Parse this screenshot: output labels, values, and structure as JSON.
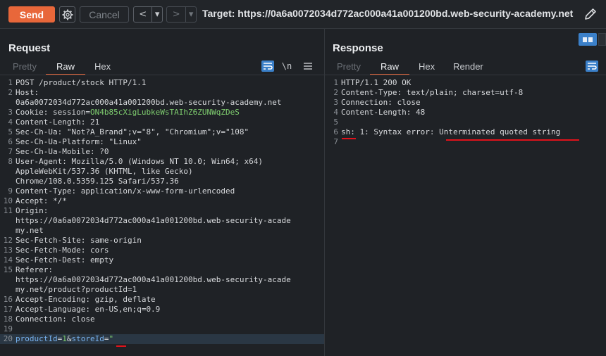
{
  "toolbar": {
    "send_label": "Send",
    "cancel_label": "Cancel",
    "back_label": "<",
    "back_dropdown": "▾",
    "forward_label": ">",
    "forward_dropdown": "▾",
    "target_label": "Target: https://0a6a0072034d772ac000a41a001200bd.web-security-academy.net",
    "gear_icon": "gear-icon",
    "edit_icon": "pencil-icon"
  },
  "colors": {
    "accent": "#e8673a",
    "highlight_blue": "#3b80c9",
    "annotation_red": "#e0121b"
  },
  "request": {
    "title": "Request",
    "tabs": [
      "Pretty",
      "Raw",
      "Hex"
    ],
    "active_tab": "Raw",
    "icons": [
      "wrap-icon",
      "newline-icon",
      "menu-icon"
    ],
    "newline_label": "\\n",
    "lines": [
      {
        "n": "1",
        "k": "",
        "v": "POST /product/stock HTTP/1.1"
      },
      {
        "n": "2",
        "k": "Host:",
        "v": ""
      },
      {
        "n": "",
        "k": "",
        "v": "0a6a0072034d772ac000a41a001200bd.web-security-academy.net"
      },
      {
        "n": "3",
        "k": "Cookie:",
        "v": " session=",
        "g": "ON4b85cXigLubkeWsTAIhZ6ZUNWqZDeS"
      },
      {
        "n": "4",
        "k": "Content-Length:",
        "v": " 21"
      },
      {
        "n": "5",
        "k": "Sec-Ch-Ua:",
        "v": " \"Not?A_Brand\";v=\"8\", \"Chromium\";v=\"108\""
      },
      {
        "n": "6",
        "k": "Sec-Ch-Ua-Platform:",
        "v": " \"Linux\""
      },
      {
        "n": "7",
        "k": "Sec-Ch-Ua-Mobile:",
        "v": " ?0"
      },
      {
        "n": "8",
        "k": "User-Agent:",
        "v": " Mozilla/5.0 (Windows NT 10.0; Win64; x64)"
      },
      {
        "n": "",
        "k": "",
        "v": "AppleWebKit/537.36 (KHTML, like Gecko)"
      },
      {
        "n": "",
        "k": "",
        "v": "Chrome/108.0.5359.125 Safari/537.36"
      },
      {
        "n": "9",
        "k": "Content-Type:",
        "v": " application/x-www-form-urlencoded"
      },
      {
        "n": "10",
        "k": "Accept:",
        "v": " */*"
      },
      {
        "n": "11",
        "k": "Origin:",
        "v": ""
      },
      {
        "n": "",
        "k": "",
        "v": "https://0a6a0072034d772ac000a41a001200bd.web-security-acade"
      },
      {
        "n": "",
        "k": "",
        "v": "my.net"
      },
      {
        "n": "12",
        "k": "Sec-Fetch-Site:",
        "v": " same-origin"
      },
      {
        "n": "13",
        "k": "Sec-Fetch-Mode:",
        "v": " cors"
      },
      {
        "n": "14",
        "k": "Sec-Fetch-Dest:",
        "v": " empty"
      },
      {
        "n": "15",
        "k": "Referer:",
        "v": ""
      },
      {
        "n": "",
        "k": "",
        "v": "https://0a6a0072034d772ac000a41a001200bd.web-security-acade"
      },
      {
        "n": "",
        "k": "",
        "v": "my.net/product?productId=1"
      },
      {
        "n": "16",
        "k": "Accept-Encoding:",
        "v": " gzip, deflate"
      },
      {
        "n": "17",
        "k": "Accept-Language:",
        "v": " en-US,en;q=0.9"
      },
      {
        "n": "18",
        "k": "Connection:",
        "v": " close"
      },
      {
        "n": "19",
        "k": "",
        "v": ""
      },
      {
        "n": "20",
        "k": "",
        "v": "",
        "body": true
      }
    ],
    "body_line": {
      "p1": "productId",
      "e1": "=",
      "v1": "1",
      "amp": "&",
      "p2": "storeId",
      "e2": "=",
      "v2": "\""
    }
  },
  "response": {
    "title": "Response",
    "tabs": [
      "Pretty",
      "Raw",
      "Hex",
      "Render"
    ],
    "active_tab": "Raw",
    "icons": [
      "wrap-icon",
      "split-view-icon"
    ],
    "lines": [
      {
        "n": "1",
        "k": "",
        "v": "HTTP/1.1 200 OK"
      },
      {
        "n": "2",
        "k": "Content-Type:",
        "v": " text/plain; charset=utf-8"
      },
      {
        "n": "3",
        "k": "Connection:",
        "v": " close"
      },
      {
        "n": "4",
        "k": "Content-Length:",
        "v": " 48"
      },
      {
        "n": "5",
        "k": "",
        "v": ""
      },
      {
        "n": "6",
        "k": "",
        "v": "sh: 1: Syntax error: Unterminated quoted string"
      },
      {
        "n": "7",
        "k": "",
        "v": ""
      }
    ]
  }
}
